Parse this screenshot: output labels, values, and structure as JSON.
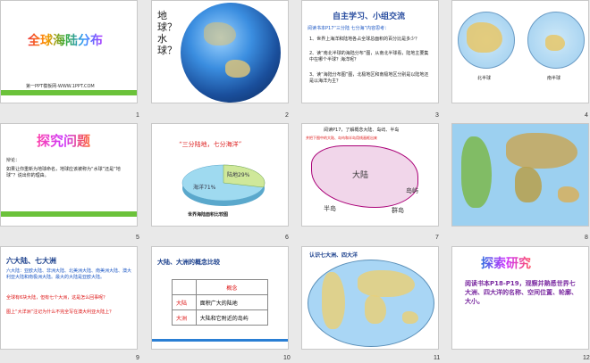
{
  "slides": [
    {
      "num": "1",
      "title": "全球海陆分布",
      "footer": "第一PPT模板网-WWW.1PPT.COM"
    },
    {
      "num": "2",
      "question": "地球？水球？"
    },
    {
      "num": "3",
      "header": "自主学习、小组交流",
      "lead": "阅读书本P17“三分陆 七分海”内容思考：",
      "items": [
        "1、世界上海洋和陆地各占全球总面积的百分比是多少？",
        "2、读“南北半球的海陆分布”图，从南北半球看，陆地主要集中在哪个半球？海洋呢？",
        "3、读“海陆分布图”图，北极地区和南极地区分别是以陆地还是以海洋为主？"
      ]
    },
    {
      "num": "4",
      "north_label": "北半球",
      "south_label": "南半球"
    },
    {
      "num": "5",
      "title": "探究问题",
      "heading": "辩论：",
      "body": "如果让你重新为地球命名，地球应该被称为“水球”还是“地球”？说出你的理由。"
    },
    {
      "num": "6",
      "subtitle": "“三分陆地，七分海洋”",
      "land_label": "陆地29%",
      "ocean_label": "海洋71%",
      "caption": "世界海陆面积比较图",
      "chart_data": {
        "type": "pie",
        "categories": [
          "陆地",
          "海洋"
        ],
        "values": [
          29,
          71
        ]
      }
    },
    {
      "num": "7",
      "lead": "阅读P17，了解概念大陆、岛屿、半岛",
      "note": "并把下图中的大陆、岛屿和半岛用线画框出来",
      "labels": {
        "continent": "大陆",
        "island": "岛屿",
        "peninsula": "半岛",
        "archipelago": "群岛"
      }
    },
    {
      "num": "8"
    },
    {
      "num": "9",
      "title": "六大陆、七大洲",
      "p1": "六大陆：亚欧大陆、非洲大陆、北美洲大陆、南美洲大陆、澳大利亚大陆和南极洲大陆。最大的大陆是亚欧大陆。",
      "p2": "全球有6块大陆，但有七个大洲，这是怎么回事呢？",
      "p3": "图上“大洋洲”注记为什么不完全写在澳大利亚大陆上？"
    },
    {
      "num": "10",
      "title": "大陆、大洲的概念比较",
      "col_header": "概念",
      "rows": [
        {
          "name": "大陆",
          "desc": "面积广大的陆地"
        },
        {
          "name": "大洲",
          "desc": "大陆和它附近的岛屿"
        }
      ]
    },
    {
      "num": "11",
      "title": "认识七大洲、四大洋"
    },
    {
      "num": "12",
      "title": "探索研究",
      "body": "阅读书本P18-P19，观察并熟悉世界七大洲、四大洋的名称、空间位置、轮廓、大小。"
    }
  ]
}
